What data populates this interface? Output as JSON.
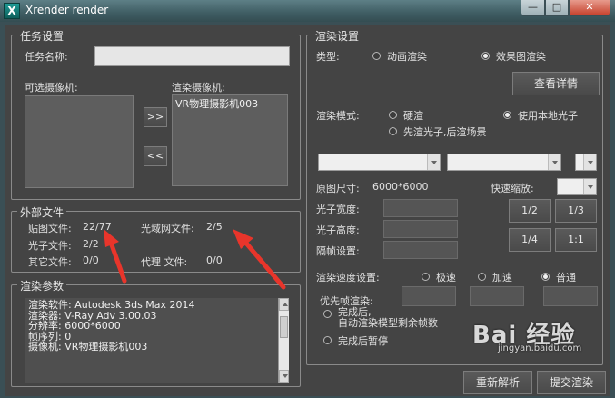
{
  "window": {
    "title": "Xrender render",
    "min_glyph": "—",
    "max_glyph": "□",
    "close_glyph": "✕",
    "icon_glyph": "X"
  },
  "task": {
    "group_title": "任务设置",
    "name_label": "任务名称:",
    "name_value": "",
    "available_cameras_label": "可选摄像机:",
    "render_cameras_label": "渲染摄像机:",
    "render_cameras": [
      "VR物理摄影机003"
    ],
    "add_button": ">>",
    "remove_button": "<<"
  },
  "external": {
    "group_title": "外部文件",
    "map_files_label": "贴图文件:",
    "map_files_value": "22/77",
    "ies_files_label": "光域网文件:",
    "ies_files_value": "2/5",
    "photon_files_label": "光子文件:",
    "photon_files_value": "2/2",
    "other_files_label": "其它文件:",
    "other_files_value": "0/0",
    "proxy_files_label": "代理   文件:",
    "proxy_files_value": "0/0"
  },
  "render_params": {
    "group_title": "渲染参数",
    "lines": [
      "渲染软件: Autodesk 3ds Max 2014",
      "渲染器: V-Ray Adv 3.00.03",
      "分辨率: 6000*6000",
      "帧序列: 0",
      "摄像机: VR物理摄影机003"
    ]
  },
  "render_settings": {
    "group_title": "渲染设置",
    "type_label": "类型:",
    "type_options": [
      {
        "label": "动画渲染",
        "selected": false
      },
      {
        "label": "效果图渲染",
        "selected": true
      }
    ],
    "details_button": "查看详情",
    "mode_label": "渲染模式:",
    "mode_options": [
      {
        "label": "硬渲",
        "selected": false
      },
      {
        "label": "使用本地光子",
        "selected": true
      },
      {
        "label": "先渲光子,后渲场景",
        "selected": false
      }
    ],
    "combo1_value": "",
    "combo2_value": "",
    "combo3_value": "",
    "original_size_label": "原图尺寸:",
    "original_size_value": "6000*6000",
    "quick_zoom_label": "快速缩放:",
    "photon_width_label": "光子宽度:",
    "photon_height_label": "光子高度:",
    "frame_interval_label": "隔帧设置:",
    "scale_buttons": [
      "1/2",
      "1/3",
      "1/4",
      "1:1"
    ],
    "speed_label": "渲染速度设置:",
    "speed_options": [
      {
        "label": "极速",
        "selected": false
      },
      {
        "label": "加速",
        "selected": false
      },
      {
        "label": "普通",
        "selected": true
      }
    ],
    "priority_label": "优先帧渲染:",
    "after_options": [
      {
        "label": "完成后,\n自动渲染模型剩余帧数",
        "selected": false
      },
      {
        "label": "完成后暂停",
        "selected": false
      }
    ]
  },
  "footer": {
    "reparse_button": "重新解析",
    "submit_button": "提交渲染"
  },
  "watermark": {
    "brand": "Bai 经验",
    "url": "jingyan.baidu.com"
  },
  "colors": {
    "annotation_arrow": "#e8352b",
    "client_bg": "#444444"
  }
}
